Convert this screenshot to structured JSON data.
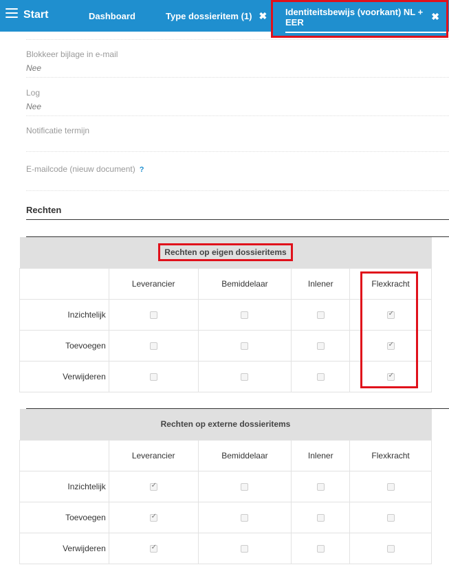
{
  "topbar": {
    "start_label": "Start",
    "tabs": [
      {
        "label": "Dashboard"
      },
      {
        "label": "Type dossieritem (1)",
        "close": "✖"
      },
      {
        "label": "Identiteitsbewijs (voorkant) NL + EER",
        "close": "✖"
      }
    ]
  },
  "fields": [
    {
      "label": "Blokkeer bijlage in e-mail",
      "value": "Nee"
    },
    {
      "label": "Log",
      "value": "Nee"
    },
    {
      "label": "Notificatie termijn",
      "value": ""
    },
    {
      "label": "E-mailcode (nieuw document)",
      "value": "",
      "help": "?"
    }
  ],
  "rechten_title": "Rechten",
  "tables": [
    {
      "title": "Rechten op eigen dossieritems",
      "columns": [
        "Leverancier",
        "Bemiddelaar",
        "Inlener",
        "Flexkracht"
      ],
      "rows": [
        {
          "label": "Inzichtelijk",
          "checked": [
            false,
            false,
            false,
            true
          ]
        },
        {
          "label": "Toevoegen",
          "checked": [
            false,
            false,
            false,
            true
          ]
        },
        {
          "label": "Verwijderen",
          "checked": [
            false,
            false,
            false,
            true
          ]
        }
      ]
    },
    {
      "title": "Rechten op externe dossieritems",
      "columns": [
        "Leverancier",
        "Bemiddelaar",
        "Inlener",
        "Flexkracht"
      ],
      "rows": [
        {
          "label": "Inzichtelijk",
          "checked": [
            true,
            false,
            false,
            false
          ]
        },
        {
          "label": "Toevoegen",
          "checked": [
            true,
            false,
            false,
            false
          ]
        },
        {
          "label": "Verwijderen",
          "checked": [
            true,
            false,
            false,
            false
          ]
        }
      ]
    }
  ]
}
